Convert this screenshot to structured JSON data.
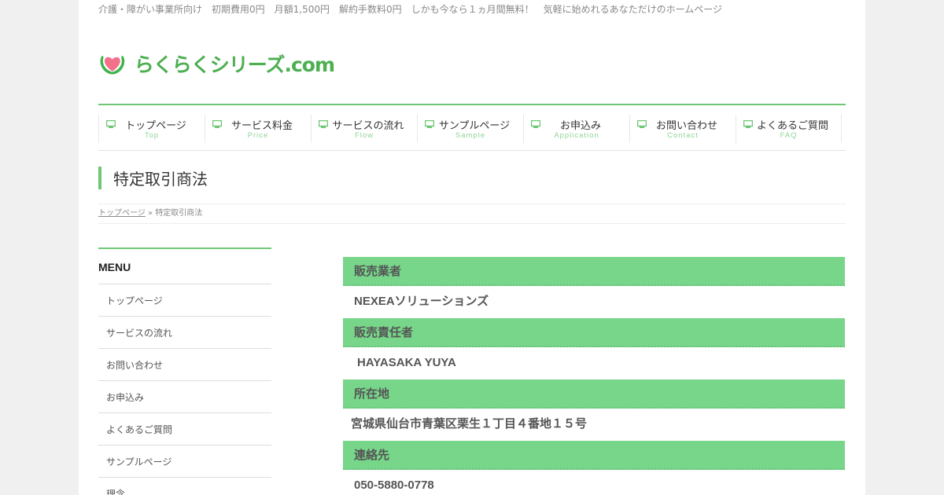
{
  "tagline": "介護・障がい事業所向け　初期費用0円　月額1,500円　解約手数料0円　しかも今なら１ヵ月間無料！　気軽に始めれるあなただけのホームページ",
  "logo": {
    "text": "らくらくシリーズ.com",
    "icon": "heart-logo-icon",
    "colors": {
      "heart": "#f2708a",
      "leaf": "#3fb34f"
    }
  },
  "nav": [
    {
      "label": "トップページ",
      "sub": "Top"
    },
    {
      "label": "サービス料金",
      "sub": "Price"
    },
    {
      "label": "サービスの流れ",
      "sub": "Flow"
    },
    {
      "label": "サンプルページ",
      "sub": "Sample"
    },
    {
      "label": "お申込み",
      "sub": "Application"
    },
    {
      "label": "お問い合わせ",
      "sub": "Contact"
    },
    {
      "label": "よくあるご質問",
      "sub": "FAQ"
    }
  ],
  "page_title": "特定取引商法",
  "breadcrumb": {
    "home": "トップページ",
    "sep": "»",
    "current": "特定取引商法"
  },
  "sidebar": {
    "heading": "MENU",
    "items": [
      "トップページ",
      "サービスの流れ",
      "お問い合わせ",
      "お申込み",
      "よくあるご質問",
      "サンプルページ",
      "理念"
    ]
  },
  "rows": [
    {
      "label": "販売業者",
      "value": "NEXEAソリューションズ"
    },
    {
      "label": "販売責任者",
      "value": " HAYASAKA YUYA"
    },
    {
      "label": "所在地",
      "value": "宮城県仙台市青葉区栗生１丁目４番地１５号"
    },
    {
      "label": "連絡先",
      "value": "050-5880-0778"
    }
  ],
  "colors": {
    "accent": "#6dc775",
    "row_header": "#77d68a"
  }
}
